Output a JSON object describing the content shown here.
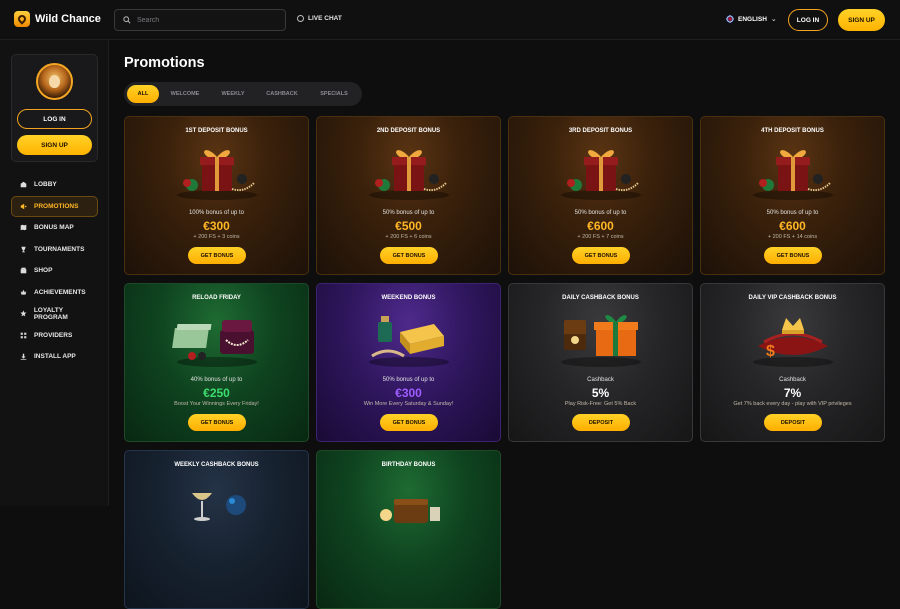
{
  "header": {
    "brand": "Wild Chance",
    "search_placeholder": "Search",
    "live_chat": "LIVE CHAT",
    "language": "ENGLISH",
    "login": "LOG IN",
    "signup": "SIGN UP"
  },
  "sidebar": {
    "login": "LOG IN",
    "signup": "SIGN UP",
    "items": [
      {
        "label": "LOBBY",
        "icon": "lobby-icon",
        "active": false
      },
      {
        "label": "PROMOTIONS",
        "icon": "megaphone-icon",
        "active": true
      },
      {
        "label": "BONUS MAP",
        "icon": "map-icon",
        "active": false
      },
      {
        "label": "TOURNAMENTS",
        "icon": "trophy-icon",
        "active": false
      },
      {
        "label": "SHOP",
        "icon": "shop-icon",
        "active": false
      },
      {
        "label": "ACHIEVEMENTS",
        "icon": "crown-icon",
        "active": false
      },
      {
        "label": "LOYALTY PROGRAM",
        "icon": "star-icon",
        "active": false
      },
      {
        "label": "PROVIDERS",
        "icon": "grid-icon",
        "active": false
      },
      {
        "label": "INSTALL APP",
        "icon": "download-icon",
        "active": false
      }
    ]
  },
  "main": {
    "title": "Promotions",
    "tabs": [
      {
        "label": "ALL",
        "active": true
      },
      {
        "label": "WELCOME",
        "active": false
      },
      {
        "label": "WEEKLY",
        "active": false
      },
      {
        "label": "CASHBACK",
        "active": false
      },
      {
        "label": "SPECIALS",
        "active": false
      }
    ]
  },
  "promos": [
    {
      "title": "1ST DEPOSIT BONUS",
      "desc": "100% bonus of up to",
      "amount": "€300",
      "extra": "+ 200 FS + 3 coins",
      "button": "GET BONUS",
      "theme": "brown",
      "amount_color": "#ffb627",
      "art": "gift"
    },
    {
      "title": "2ND DEPOSIT BONUS",
      "desc": "50% bonus of up to",
      "amount": "€500",
      "extra": "+ 200 FS + 6 coins",
      "button": "GET BONUS",
      "theme": "brown",
      "amount_color": "#ffb627",
      "art": "gift"
    },
    {
      "title": "3RD DEPOSIT BONUS",
      "desc": "50% bonus of up to",
      "amount": "€600",
      "extra": "+ 200 FS + 7 coins",
      "button": "GET BONUS",
      "theme": "brown",
      "amount_color": "#ffb627",
      "art": "gift"
    },
    {
      "title": "4TH DEPOSIT BONUS",
      "desc": "50% bonus of up to",
      "amount": "€600",
      "extra": "+ 200 FS + 14 coins",
      "button": "GET BONUS",
      "theme": "brown",
      "amount_color": "#ffb627",
      "art": "gift"
    },
    {
      "title": "RELOAD FRIDAY",
      "desc": "40% bonus of up to",
      "amount": "€250",
      "extra": "Boost Your Winnings Every Friday!",
      "button": "GET BONUS",
      "theme": "green",
      "amount_color": "#3ddc6e",
      "art": "money"
    },
    {
      "title": "WEEKEND BONUS",
      "desc": "50% bonus of up to",
      "amount": "€300",
      "extra": "Win More Every Saturday & Sunday!",
      "button": "GET BONUS",
      "theme": "purple",
      "amount_color": "#a05cff",
      "art": "gold"
    },
    {
      "title": "DAILY CASHBACK BONUS",
      "desc": "Cashback",
      "amount": "5%",
      "extra": "Play Risk-Free: Get 5% Back",
      "button": "DEPOSIT",
      "theme": "gray",
      "amount_color": "#ffffff",
      "art": "cashback"
    },
    {
      "title": "DAILY VIP CASHBACK BONUS",
      "desc": "Cashback",
      "amount": "7%",
      "extra": "Get 7% back every day - play with VIP privileges",
      "button": "DEPOSIT",
      "theme": "gray",
      "amount_color": "#ffffff",
      "art": "pillow"
    },
    {
      "title": "WEEKLY CASHBACK BONUS",
      "desc": "",
      "amount": "",
      "extra": "",
      "button": "",
      "theme": "navy",
      "amount_color": "#ffffff",
      "art": "glass"
    },
    {
      "title": "BIRTHDAY BONUS",
      "desc": "",
      "amount": "",
      "extra": "",
      "button": "",
      "theme": "green",
      "amount_color": "#ffffff",
      "art": "wallet"
    }
  ]
}
